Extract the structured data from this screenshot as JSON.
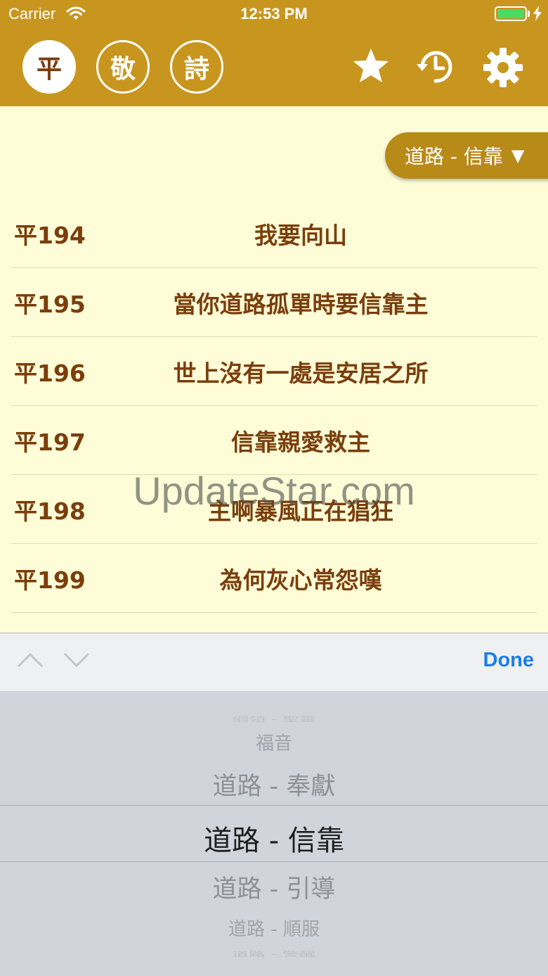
{
  "status_bar": {
    "carrier": "Carrier",
    "time": "12:53 PM"
  },
  "nav": {
    "tabs": [
      {
        "label": "平",
        "active": true
      },
      {
        "label": "敬",
        "active": false
      },
      {
        "label": "詩",
        "active": false
      }
    ],
    "icons": [
      "star-icon",
      "history-icon",
      "gear-icon"
    ]
  },
  "category": {
    "label": "道路 - 信靠",
    "arrow": "▼"
  },
  "hymns": [
    {
      "number": "平194",
      "title": "我要向山"
    },
    {
      "number": "平195",
      "title": "當你道路孤單時要信靠主"
    },
    {
      "number": "平196",
      "title": "世上沒有一處是安居之所"
    },
    {
      "number": "平197",
      "title": "信靠親愛救主"
    },
    {
      "number": "平198",
      "title": "主啊暴風正在猖狂"
    },
    {
      "number": "平199",
      "title": "為何灰心常怨嘆"
    }
  ],
  "watermark": "UpdateStar.com",
  "toolbar": {
    "done_label": "Done"
  },
  "picker": {
    "options": [
      "福音",
      "道路 - 奉獻",
      "道路 - 信靠",
      "道路 - 引導",
      "道路 - 順服"
    ],
    "selected": "道路 - 信靠"
  },
  "colors": {
    "accent": "#c8961e",
    "background": "#fefdd8",
    "text_brown": "#7a3e0c",
    "done_blue": "#1a7ee6"
  }
}
